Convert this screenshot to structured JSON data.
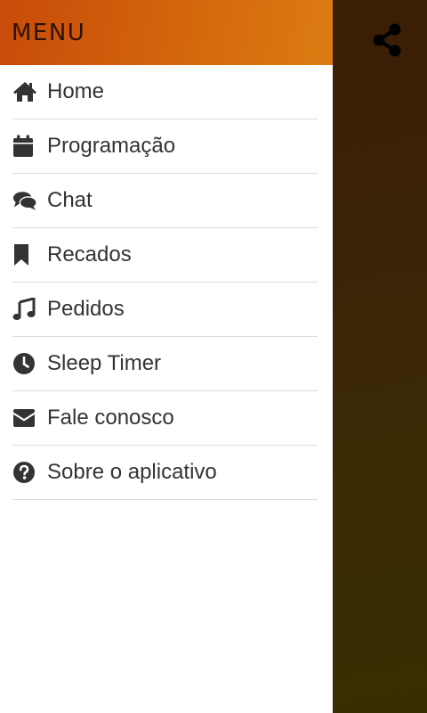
{
  "drawer": {
    "title": "MENU",
    "items": [
      {
        "label": "Home",
        "icon": "home-icon"
      },
      {
        "label": "Programação",
        "icon": "calendar-icon"
      },
      {
        "label": "Chat",
        "icon": "chat-icon"
      },
      {
        "label": "Recados",
        "icon": "bookmark-icon"
      },
      {
        "label": "Pedidos",
        "icon": "music-note-icon"
      },
      {
        "label": "Sleep Timer",
        "icon": "clock-icon"
      },
      {
        "label": "Fale conosco",
        "icon": "envelope-icon"
      },
      {
        "label": "Sobre o aplicativo",
        "icon": "question-circle-icon"
      }
    ]
  },
  "top_bar": {
    "share_icon": "share-icon"
  },
  "colors": {
    "header_gradient_start": "#c84b0a",
    "header_gradient_end": "#dc7c12",
    "backdrop": "#3a2a05",
    "text": "#333333",
    "divider": "#dcdcdc"
  }
}
